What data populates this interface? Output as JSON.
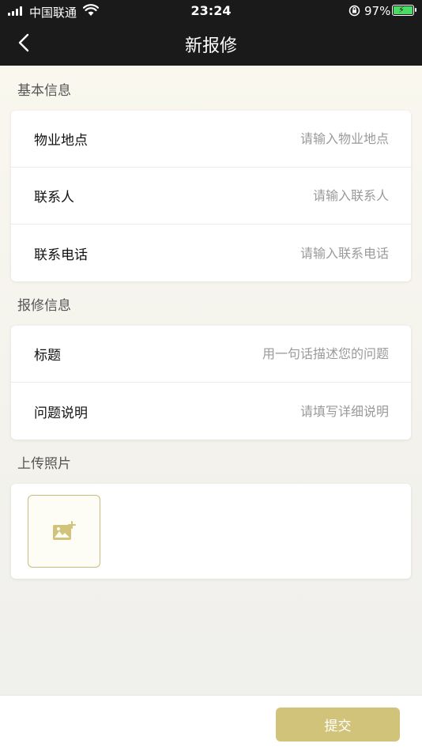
{
  "status_bar": {
    "carrier": "中国联通",
    "time": "23:24",
    "battery": "97%"
  },
  "nav": {
    "title": "新报修",
    "back_icon": "chevron-left-icon"
  },
  "basic_info": {
    "section_label": "基本信息",
    "property_location": {
      "label": "物业地点",
      "placeholder": "请输入物业地点",
      "value": ""
    },
    "contact_person": {
      "label": "联系人",
      "placeholder": "请输入联系人",
      "value": ""
    },
    "contact_phone": {
      "label": "联系电话",
      "placeholder": "请输入联系电话",
      "value": ""
    }
  },
  "repair_info": {
    "section_label": "报修信息",
    "title": {
      "label": "标题",
      "placeholder": "用一句话描述您的问题",
      "value": ""
    },
    "description": {
      "label": "问题说明",
      "placeholder": "请填写详细说明",
      "value": ""
    }
  },
  "photos": {
    "section_label": "上传照片",
    "add_icon": "add-image-icon"
  },
  "footer": {
    "submit_label": "提交"
  },
  "colors": {
    "accent": "#d2c37a",
    "header_bg": "#1a1a1a"
  }
}
